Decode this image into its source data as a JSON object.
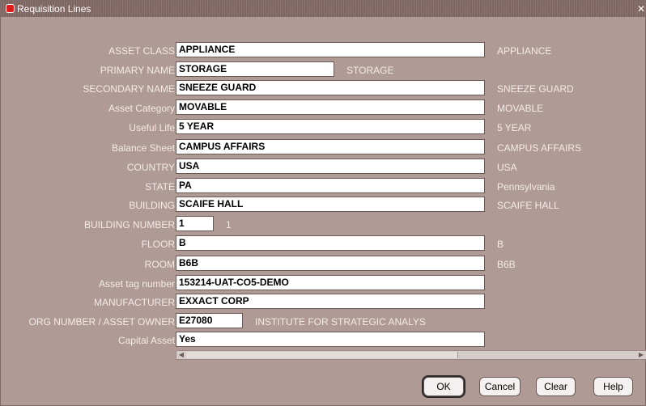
{
  "window": {
    "title": "Requisition Lines"
  },
  "rows": [
    {
      "label": "ASSET CLASS",
      "value": "APPLIANCE",
      "desc": "APPLIANCE"
    },
    {
      "label": "PRIMARY NAME",
      "value": "STORAGE",
      "desc": "STORAGE"
    },
    {
      "label": "SECONDARY NAME",
      "value": "SNEEZE GUARD",
      "desc": "SNEEZE GUARD"
    },
    {
      "label": "Asset Category",
      "value": "MOVABLE",
      "desc": "MOVABLE"
    },
    {
      "label": "Useful Life",
      "value": "5 YEAR",
      "desc": "5 YEAR"
    },
    {
      "label": "Balance Sheet",
      "value": "CAMPUS AFFAIRS",
      "desc": "CAMPUS AFFAIRS"
    },
    {
      "label": "COUNTRY",
      "value": "USA",
      "desc": "USA"
    },
    {
      "label": "STATE",
      "value": "PA",
      "desc": "Pennsylvania"
    },
    {
      "label": "BUILDING",
      "value": "SCAIFE HALL",
      "desc": "SCAIFE HALL"
    },
    {
      "label": "BUILDING NUMBER",
      "value": "1",
      "desc": "1"
    },
    {
      "label": "FLOOR",
      "value": "B",
      "desc": "B"
    },
    {
      "label": "ROOM",
      "value": "B6B",
      "desc": "B6B"
    },
    {
      "label": "Asset tag number",
      "value": "153214-UAT-CO5-DEMO",
      "desc": ""
    },
    {
      "label": "MANUFACTURER",
      "value": "EXXACT CORP",
      "desc": ""
    },
    {
      "label": "ORG NUMBER / ASSET OWNER",
      "value": "E27080",
      "desc": "INSTITUTE FOR STRATEGIC ANALYS"
    },
    {
      "label": "Capital Asset",
      "value": "Yes",
      "desc": ""
    }
  ],
  "buttons": {
    "ok": "OK",
    "cancel": "Cancel",
    "clear": "Clear",
    "help": "Help"
  },
  "colors": {
    "window_bg": "#b09a96",
    "titlebar": "#7e6561",
    "field_bg": "#ffffff"
  }
}
